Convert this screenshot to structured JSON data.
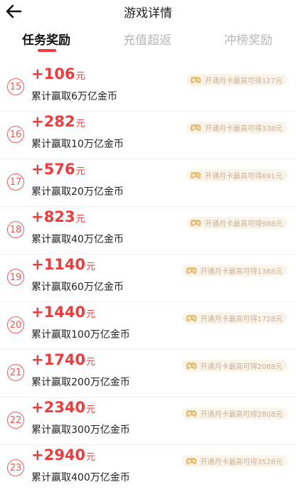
{
  "header": {
    "title": "游戏详情"
  },
  "tabs": [
    {
      "label": "任务奖励",
      "active": true
    },
    {
      "label": "充值超返",
      "active": false
    },
    {
      "label": "冲榜奖励",
      "active": false
    }
  ],
  "reward_unit": "元",
  "badge_icon": "gamepad-icon",
  "rows": [
    {
      "num": "15",
      "amount": "+106",
      "desc": "累计赢取6万亿金币",
      "badge": "开通月卡最高可得127元"
    },
    {
      "num": "16",
      "amount": "+282",
      "desc": "累计赢取10万亿金币",
      "badge": "开通月卡最高可得338元"
    },
    {
      "num": "17",
      "amount": "+576",
      "desc": "累计赢取20万亿金币",
      "badge": "开通月卡最高可得691元"
    },
    {
      "num": "18",
      "amount": "+823",
      "desc": "累计赢取40万亿金币",
      "badge": "开通月卡最高可得988元"
    },
    {
      "num": "19",
      "amount": "+1140",
      "desc": "累计赢取60万亿金币",
      "badge": "开通月卡最高可得1368元"
    },
    {
      "num": "20",
      "amount": "+1440",
      "desc": "累计赢取100万亿金币",
      "badge": "开通月卡最高可得1728元"
    },
    {
      "num": "21",
      "amount": "+1740",
      "desc": "累计赢取200万亿金币",
      "badge": "开通月卡最高可得2088元"
    },
    {
      "num": "22",
      "amount": "+2340",
      "desc": "累计赢取300万亿金币",
      "badge": "开通月卡最高可得2808元"
    },
    {
      "num": "23",
      "amount": "+2940",
      "desc": "累计赢取400万亿金币",
      "badge": "开通月卡最高可得3528元"
    }
  ],
  "colors": {
    "accent": "#f03a3f",
    "badge_bg": "#fbf4ea",
    "badge_text": "#c7b298",
    "gamepad": "#e3c27b"
  }
}
